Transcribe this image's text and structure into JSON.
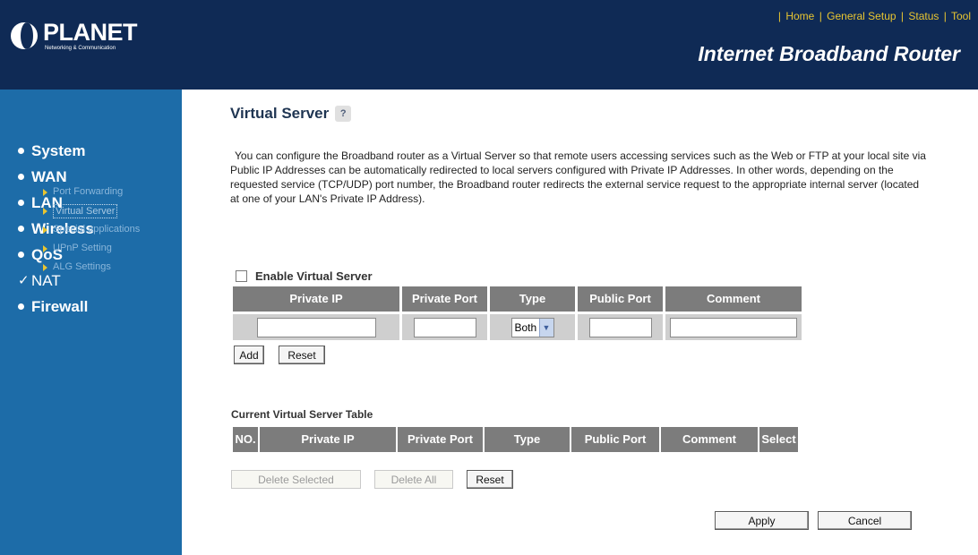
{
  "header": {
    "brand": "PLANET",
    "tagline": "Networking & Communication",
    "product_title": "Internet Broadband Router",
    "nav": [
      "Home",
      "General Setup",
      "Status",
      "Tool"
    ]
  },
  "sidebar": {
    "items": [
      {
        "label": "System",
        "marker": "bullet"
      },
      {
        "label": "WAN",
        "marker": "bullet"
      },
      {
        "label": "LAN",
        "marker": "bullet"
      },
      {
        "label": "Wireless",
        "marker": "bullet"
      },
      {
        "label": "QoS",
        "marker": "bullet"
      },
      {
        "label": "NAT",
        "marker": "check"
      },
      {
        "label": "Firewall",
        "marker": "bullet"
      }
    ],
    "nat_submenu": [
      "Port Forwarding",
      "Virtual Server",
      "Special applications",
      "UPnP Setting",
      "ALG Settings"
    ],
    "current_submenu": "Virtual Server"
  },
  "page": {
    "title": "Virtual Server",
    "help_icon": "?",
    "description": "You can configure the Broadband router as a Virtual Server so that remote users accessing services such as the Web or FTP at your local site via Public IP Addresses can be automatically redirected to local servers configured with Private IP Addresses. In other words, depending on the requested service (TCP/UDP) port number, the Broadband router redirects the external service request to the appropriate internal server (located at one of your LAN's Private IP Address)."
  },
  "form": {
    "enable_label": "Enable Virtual Server",
    "enable_checked": false,
    "columns": [
      "Private IP",
      "Private Port",
      "Type",
      "Public Port",
      "Comment"
    ],
    "private_ip_value": "",
    "private_port_value": "",
    "type_value": "Both",
    "public_port_value": "",
    "comment_value": "",
    "add_label": "Add",
    "reset_label": "Reset"
  },
  "table": {
    "title": "Current Virtual Server Table",
    "columns": [
      "NO.",
      "Private IP",
      "Private Port",
      "Type",
      "Public Port",
      "Comment",
      "Select"
    ],
    "delete_selected_label": "Delete Selected",
    "delete_all_label": "Delete All",
    "reset_label": "Reset"
  },
  "footer": {
    "apply_label": "Apply",
    "cancel_label": "Cancel"
  },
  "colors": {
    "header_bg": "#0f2a55",
    "sidebar_bg": "#1d6ca8",
    "nav_link": "#e8c531",
    "table_header": "#7c7c7c"
  }
}
